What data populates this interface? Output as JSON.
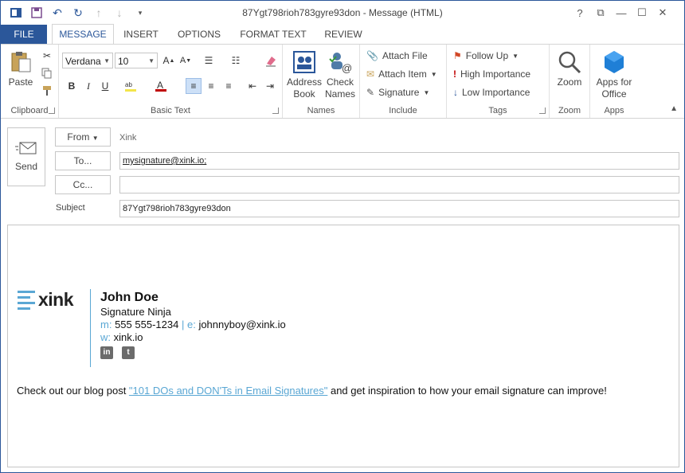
{
  "window": {
    "title": "87Ygt798rioh783gyre93don - Message (HTML)",
    "controls": {
      "help": "?",
      "restore_ribbon": "⧉",
      "minimize": "—",
      "maximize": "☐",
      "close": "✕"
    }
  },
  "tabs": [
    "FILE",
    "MESSAGE",
    "INSERT",
    "OPTIONS",
    "FORMAT TEXT",
    "REVIEW"
  ],
  "ribbon": {
    "clipboard": {
      "label": "Clipboard",
      "paste": "Paste"
    },
    "basic_text": {
      "label": "Basic Text",
      "font": "Verdana",
      "size": "10"
    },
    "names": {
      "label": "Names",
      "address_book": [
        "Address",
        "Book"
      ],
      "check_names": [
        "Check",
        "Names"
      ]
    },
    "include": {
      "label": "Include",
      "attach_file": "Attach File",
      "attach_item": "Attach Item",
      "signature": "Signature"
    },
    "tags": {
      "label": "Tags",
      "follow_up": "Follow Up",
      "high": "High Importance",
      "low": "Low Importance"
    },
    "zoom": {
      "label": "Zoom",
      "button": "Zoom"
    },
    "apps": {
      "label": "Apps",
      "button": [
        "Apps for",
        "Office"
      ]
    }
  },
  "header": {
    "send": "Send",
    "from_button": "From",
    "from_value": "Xink",
    "to_button": "To...",
    "to_value": "mysignature@xink.io;",
    "cc_button": "Cc...",
    "cc_value": "",
    "subject_label": "Subject",
    "subject_value": "87Ygt798rioh783gyre93don"
  },
  "signature": {
    "logo_text": "xink",
    "name": "John Doe",
    "title": "Signature Ninja",
    "m_label": "m:",
    "phone": "555 555-1234",
    "sep": "|",
    "e_label": "e:",
    "email": "johnnyboy@xink.io",
    "w_label": "w:",
    "website": "xink.io",
    "social": [
      "in",
      "t"
    ]
  },
  "blog": {
    "before": "Check out our blog post ",
    "link": "\"101 DOs and DON'Ts in Email Signatures\"",
    "after": " and get inspiration to how your email signature can improve!"
  },
  "colors": {
    "accent": "#2b579a",
    "signature_blue": "#5aa7d4"
  }
}
